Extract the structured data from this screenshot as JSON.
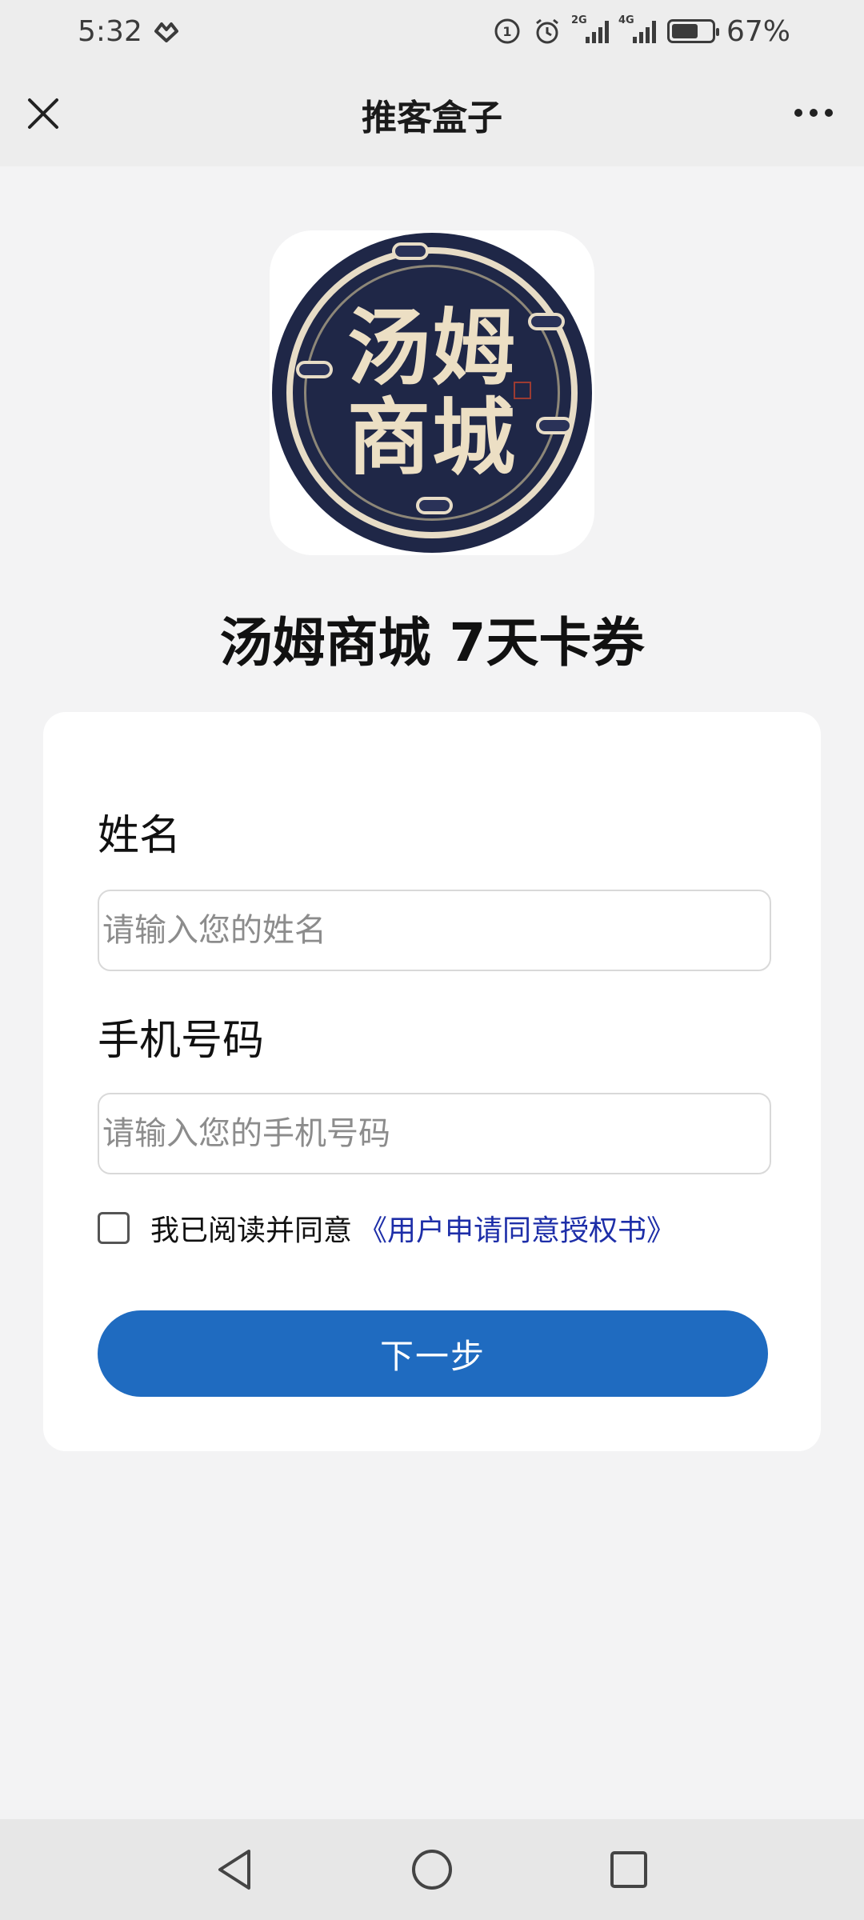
{
  "status_bar": {
    "time": "5:32",
    "battery_percent": "67%",
    "battery_level": 0.67,
    "net_tag_1": "2G",
    "net_tag_2": "4G"
  },
  "header": {
    "title": "推客盒子",
    "close_icon": "close-icon",
    "more_icon": "more-dots-icon"
  },
  "logo": {
    "line1": "汤姆",
    "line2": "商城"
  },
  "product": {
    "title": "汤姆商城 7天卡券"
  },
  "form": {
    "name_label": "姓名",
    "name_placeholder": "请输入您的姓名",
    "name_value": "",
    "phone_label": "手机号码",
    "phone_placeholder": "请输入您的手机号码",
    "phone_value": "",
    "consent_checked": false,
    "consent_text": "我已阅读并同意",
    "consent_link": "《用户申请同意授权书》",
    "next_label": "下一步"
  },
  "nav": {
    "back_icon": "back-triangle-icon",
    "home_icon": "home-circle-icon",
    "recents_icon": "recents-square-icon"
  },
  "colors": {
    "primary": "#1f6bc0",
    "link": "#1d2ea8",
    "page_bg": "#f3f3f4",
    "logo_bg": "#1f2747"
  }
}
